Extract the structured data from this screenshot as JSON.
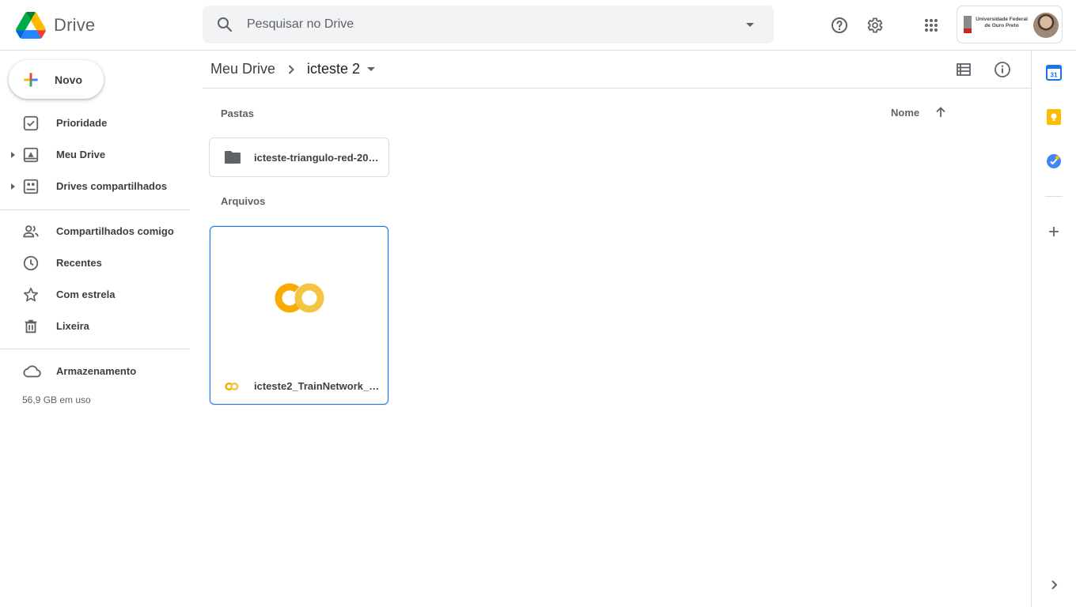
{
  "app": {
    "name": "Drive"
  },
  "search": {
    "placeholder": "Pesquisar no Drive"
  },
  "account": {
    "org_line1": "Universidade Federal",
    "org_line2": "de Ouro Preto"
  },
  "sidebar": {
    "new_button": "Novo",
    "items": [
      {
        "label": "Prioridade",
        "icon": "priority-icon"
      },
      {
        "label": "Meu Drive",
        "icon": "my-drive-icon"
      },
      {
        "label": "Drives compartilhados",
        "icon": "shared-drives-icon"
      },
      {
        "label": "Compartilhados comigo",
        "icon": "shared-with-me-icon"
      },
      {
        "label": "Recentes",
        "icon": "clock-icon"
      },
      {
        "label": "Com estrela",
        "icon": "star-icon"
      },
      {
        "label": "Lixeira",
        "icon": "trash-icon"
      }
    ],
    "storage": {
      "label": "Armazenamento",
      "usage": "56,9 GB em uso"
    }
  },
  "breadcrumb": {
    "root": "Meu Drive",
    "current": "icteste 2"
  },
  "main": {
    "folders_label": "Pastas",
    "files_label": "Arquivos",
    "sort_label": "Nome",
    "sort_direction": "ascending",
    "folders": [
      {
        "name": "icteste-triangulo-red-202…"
      }
    ],
    "files": [
      {
        "name": "icteste2_TrainNetwork_V…",
        "type": "colab-notebook",
        "selected": true
      }
    ]
  },
  "colors": {
    "accent": "#1a73e8",
    "colab_orange": "#f9ab00",
    "colab_yellow": "#f4c542",
    "calendar_blue": "#1a73e8",
    "keep_yellow": "#fbbc04",
    "tasks_blue": "#4285f4"
  }
}
